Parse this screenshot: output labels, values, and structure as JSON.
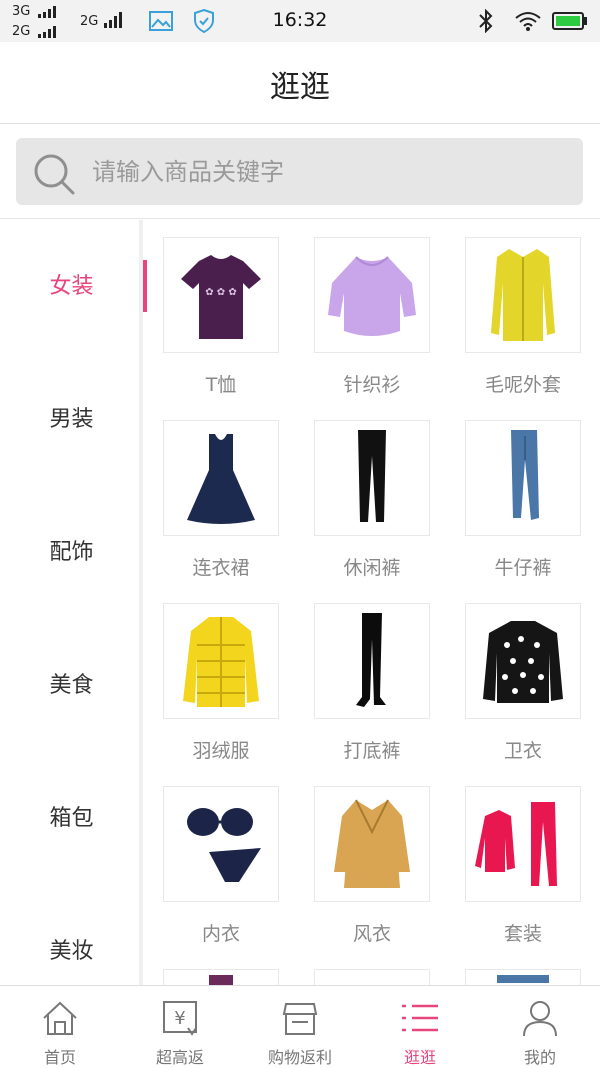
{
  "status_bar": {
    "net1": "3G",
    "net2": "2G",
    "net3": "2G",
    "time": "16:32"
  },
  "header": {
    "title": "逛逛"
  },
  "search": {
    "placeholder": "请输入商品关键字"
  },
  "sidebar": {
    "items": [
      {
        "label": "女装",
        "active": true
      },
      {
        "label": "男装",
        "active": false
      },
      {
        "label": "配饰",
        "active": false
      },
      {
        "label": "美食",
        "active": false
      },
      {
        "label": "箱包",
        "active": false
      },
      {
        "label": "美妆",
        "active": false
      }
    ]
  },
  "categories": [
    {
      "label": "T恤",
      "icon": "tshirt-image"
    },
    {
      "label": "针织衫",
      "icon": "knit-sweater-image"
    },
    {
      "label": "毛呢外套",
      "icon": "wool-coat-image"
    },
    {
      "label": "连衣裙",
      "icon": "dress-image"
    },
    {
      "label": "休闲裤",
      "icon": "casual-pants-image"
    },
    {
      "label": "牛仔裤",
      "icon": "jeans-image"
    },
    {
      "label": "羽绒服",
      "icon": "down-jacket-image"
    },
    {
      "label": "打底裤",
      "icon": "leggings-image"
    },
    {
      "label": "卫衣",
      "icon": "hoodie-image"
    },
    {
      "label": "内衣",
      "icon": "lingerie-image"
    },
    {
      "label": "风衣",
      "icon": "trench-coat-image"
    },
    {
      "label": "套装",
      "icon": "tracksuit-image"
    }
  ],
  "tabbar": {
    "items": [
      {
        "label": "首页",
        "icon": "home-icon",
        "active": false
      },
      {
        "label": "超高返",
        "icon": "yen-rebate-icon",
        "active": false
      },
      {
        "label": "购物返利",
        "icon": "store-icon",
        "active": false
      },
      {
        "label": "逛逛",
        "icon": "list-icon",
        "active": true
      },
      {
        "label": "我的",
        "icon": "user-icon",
        "active": false
      }
    ]
  },
  "colors": {
    "accent": "#e8457a",
    "text": "#333333",
    "muted": "#888888",
    "search_bg": "#e6e6e6"
  }
}
